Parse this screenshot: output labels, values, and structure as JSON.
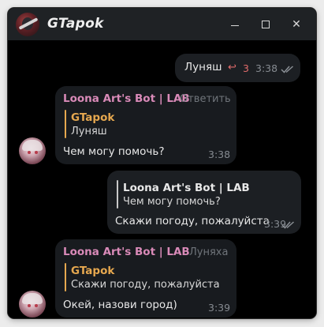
{
  "window": {
    "title": "GTapok",
    "controls": {
      "minimize_icon": "minimize-icon",
      "maximize_icon": "maximize-icon",
      "close_icon": "close-icon",
      "close_glyph": "✕"
    }
  },
  "colors": {
    "sender_name": "#d98ab8",
    "quote_accent": "#e6a84f",
    "reply_accent": "#e16b6b",
    "bubble_bg": "#1c1f23",
    "chat_bg": "#000000"
  },
  "messages": [
    {
      "direction": "outgoing",
      "text": "Луняш",
      "replies": "3",
      "time": "3:38",
      "status_icon": "double-check-icon"
    },
    {
      "direction": "incoming",
      "sender": "Loona Art's Bot | LAB",
      "action": "Ответить",
      "quote": {
        "name": "GTapok",
        "text": "Луняш"
      },
      "text": "Чем могу помочь?",
      "time": "3:38"
    },
    {
      "direction": "outgoing",
      "quote": {
        "name": "Loona Art's Bot | LAB",
        "text": "Чем могу помочь?"
      },
      "text": "Скажи погоду, пожалуйста",
      "time": "3:39",
      "status_icon": "double-check-icon"
    },
    {
      "direction": "incoming",
      "sender": "Loona Art's Bot | LAB",
      "action": "Луняха",
      "quote": {
        "name": "GTapok",
        "text": "Скажи погоду, пожалуйста"
      },
      "text": "Окей, назови город)",
      "time": "3:39"
    }
  ]
}
